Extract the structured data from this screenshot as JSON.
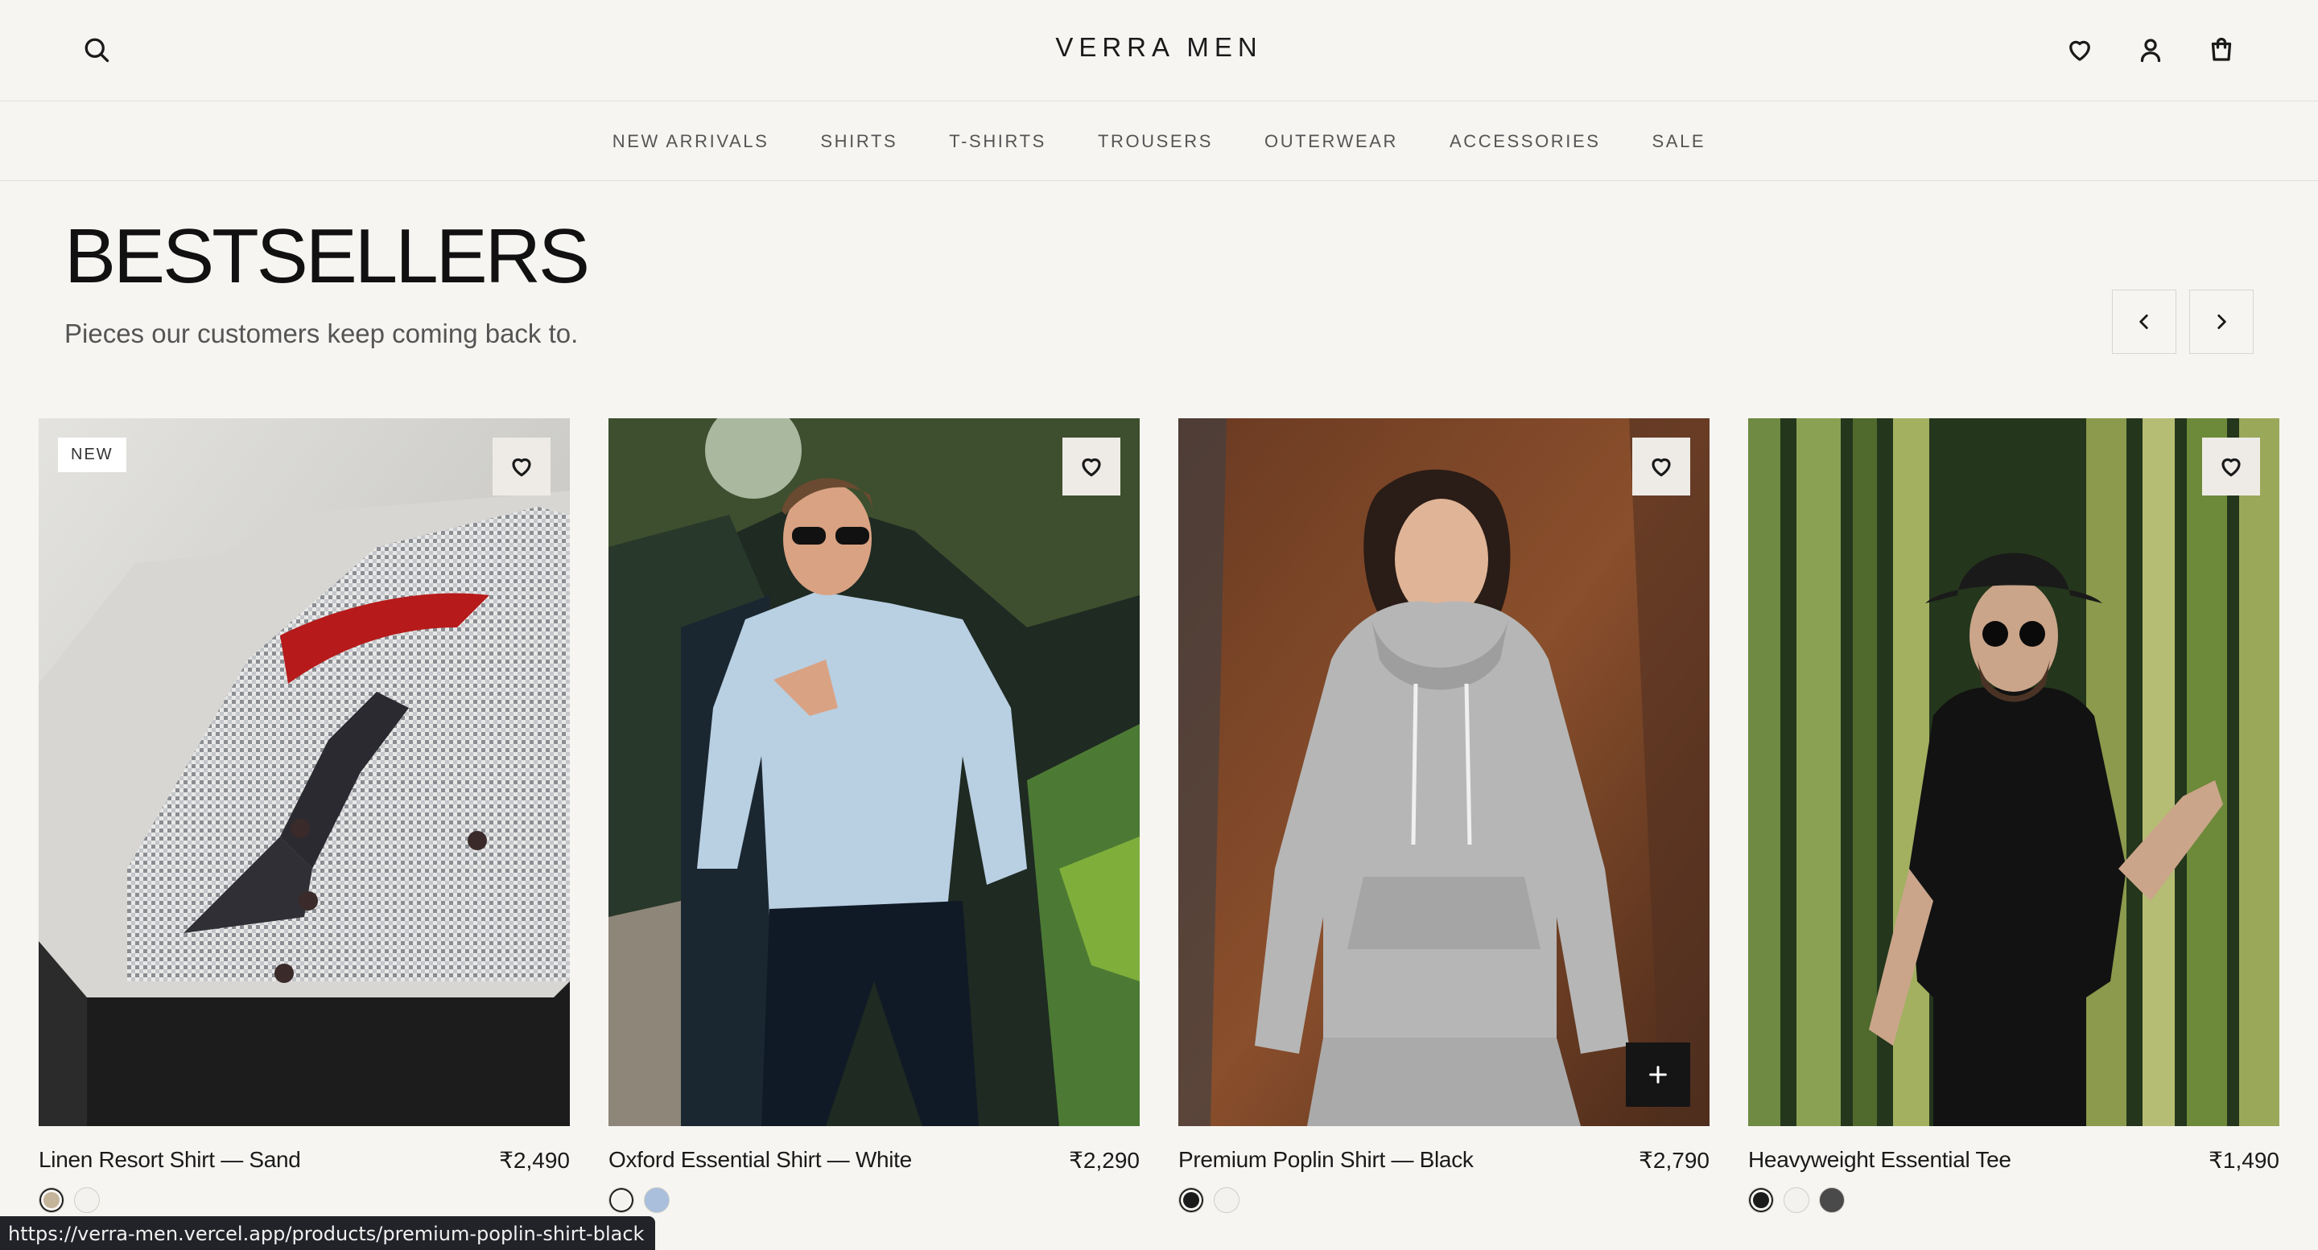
{
  "header": {
    "logo": "VERRA MEN",
    "icons": [
      "search-icon",
      "heart-icon",
      "user-icon",
      "shopping-bag-icon"
    ]
  },
  "nav": {
    "items": [
      "NEW ARRIVALS",
      "SHIRTS",
      "T-SHIRTS",
      "TROUSERS",
      "OUTERWEAR",
      "ACCESSORIES",
      "SALE"
    ]
  },
  "section": {
    "title": "BESTSELLERS",
    "subtitle": "Pieces our customers keep coming back to."
  },
  "products": [
    {
      "name": "Linen Resort Shirt — Sand",
      "price": "₹2,490",
      "badge": "NEW",
      "swatches": [
        "#c4b49a",
        "#f4f2ee"
      ],
      "selected_swatch": 0
    },
    {
      "name": "Oxford Essential Shirt — White",
      "price": "₹2,290",
      "swatches": [
        "#f4f2ee",
        "#a9bfdc"
      ],
      "selected_swatch": 0
    },
    {
      "name": "Premium Poplin Shirt — Black",
      "price": "₹2,790",
      "swatches": [
        "#1b1b1b",
        "#f4f2ee"
      ],
      "selected_swatch": 0
    },
    {
      "name": "Heavyweight Essential Tee",
      "price": "₹1,490",
      "swatches": [
        "#1b1b1b",
        "#f4f2ee",
        "#4a4a4a"
      ],
      "selected_swatch": 0
    }
  ],
  "status_url": "https://verra-men.vercel.app/products/premium-poplin-shirt-black",
  "colors": {
    "background": "#f6f5f2",
    "text": "#1a1a1a",
    "muted": "#555555",
    "dark_button": "#151515"
  }
}
